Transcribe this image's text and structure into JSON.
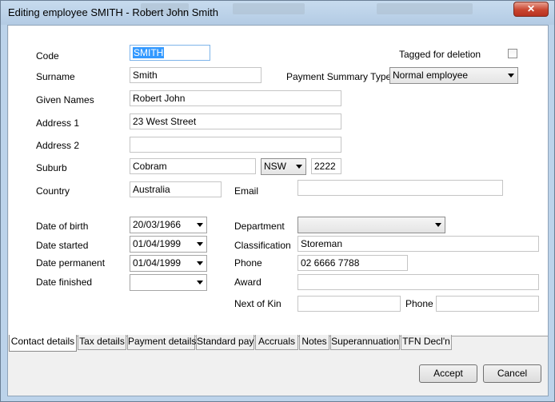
{
  "window": {
    "title": "Editing employee SMITH - Robert John Smith",
    "close_label": "✕"
  },
  "form": {
    "code": {
      "label": "Code",
      "value": "SMITH"
    },
    "tagged": {
      "label": "Tagged for deletion",
      "checked": false
    },
    "surname": {
      "label": "Surname",
      "value": "Smith"
    },
    "payment_summary_type": {
      "label": "Payment Summary Type",
      "value": "Normal employee"
    },
    "given_names": {
      "label": "Given Names",
      "value": "Robert John"
    },
    "address1": {
      "label": "Address 1",
      "value": "23 West Street"
    },
    "address2": {
      "label": "Address 2",
      "value": ""
    },
    "suburb": {
      "label": "Suburb",
      "value": "Cobram"
    },
    "state": {
      "value": "NSW"
    },
    "postcode": {
      "value": "2222"
    },
    "country": {
      "label": "Country",
      "value": "Australia"
    },
    "email": {
      "label": "Email",
      "value": ""
    },
    "dob": {
      "label": "Date of birth",
      "value": "20/03/1966"
    },
    "date_started": {
      "label": "Date started",
      "value": "01/04/1999"
    },
    "date_permanent": {
      "label": "Date permanent",
      "value": "01/04/1999"
    },
    "date_finished": {
      "label": "Date finished",
      "value": ""
    },
    "department": {
      "label": "Department",
      "value": ""
    },
    "classification": {
      "label": "Classification",
      "value": "Storeman"
    },
    "phone": {
      "label": "Phone",
      "value": "02 6666 7788"
    },
    "award": {
      "label": "Award",
      "value": ""
    },
    "next_of_kin": {
      "label": "Next of Kin",
      "value": ""
    },
    "kin_phone": {
      "label": "Phone",
      "value": ""
    }
  },
  "tabs": [
    {
      "label": "Contact details",
      "active": true
    },
    {
      "label": "Tax details"
    },
    {
      "label": "Payment details"
    },
    {
      "label": "Standard pay"
    },
    {
      "label": "Accruals"
    },
    {
      "label": "Notes"
    },
    {
      "label": "Superannuation"
    },
    {
      "label": "TFN Decl'n"
    }
  ],
  "buttons": {
    "accept": "Accept",
    "cancel": "Cancel"
  }
}
